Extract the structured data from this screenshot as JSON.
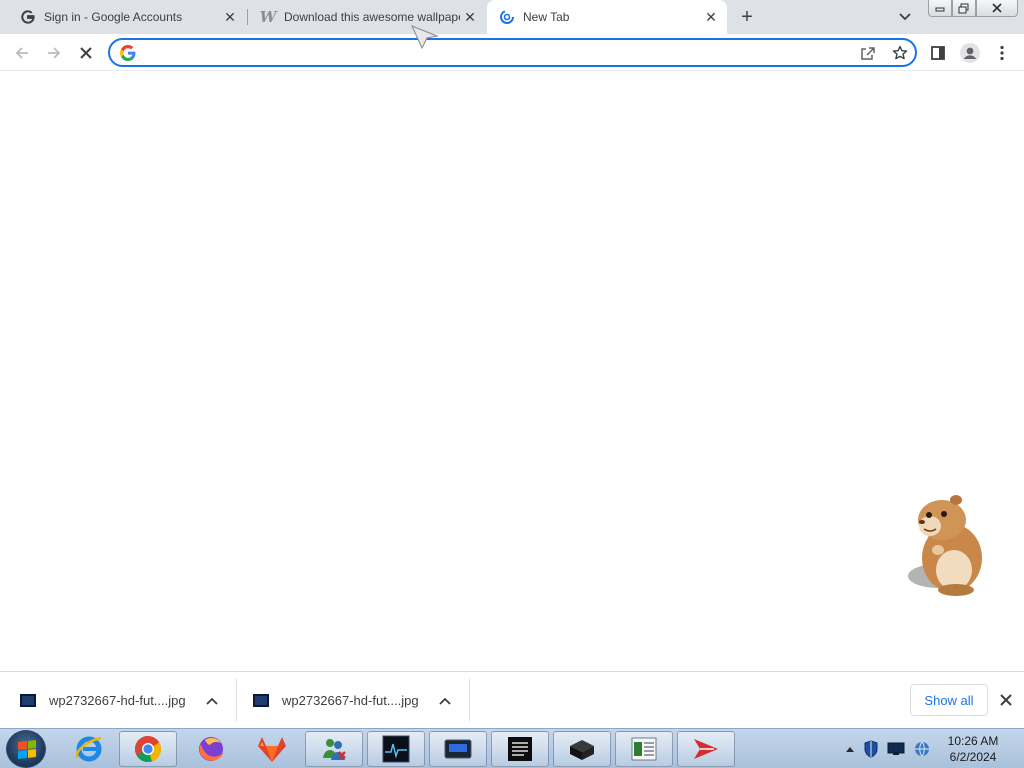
{
  "browser": {
    "tabs": [
      {
        "title": "Sign in - Google Accounts",
        "favicon": "google-g-icon",
        "active": false
      },
      {
        "title": "Download this awesome wallpaper",
        "favicon": "wallpaper-w-icon",
        "active": false
      },
      {
        "title": "New Tab",
        "favicon": "loading-spinner-icon",
        "active": true
      }
    ],
    "address": {
      "value": "",
      "placeholder": ""
    }
  },
  "downloads": {
    "items": [
      {
        "filename": "wp2732667-hd-fut....jpg"
      },
      {
        "filename": "wp2732667-hd-fut....jpg"
      }
    ],
    "show_all_label": "Show all"
  },
  "taskbar": {
    "apps": [
      "internet-explorer-icon",
      "chrome-icon",
      "firefox-icon",
      "gitlab-fox-icon",
      "network-users-icon",
      "activity-monitor-icon",
      "display-app-icon",
      "terminal-app-icon",
      "black-box-app-icon",
      "spreadsheet-app-icon",
      "red-arrow-app-icon"
    ],
    "clock": {
      "time": "10:26 AM",
      "date": "6/2/2024"
    }
  },
  "colors": {
    "accent": "#1a73e8",
    "tabstrip": "#dee1e6",
    "taskbar": "#b8cde4"
  }
}
